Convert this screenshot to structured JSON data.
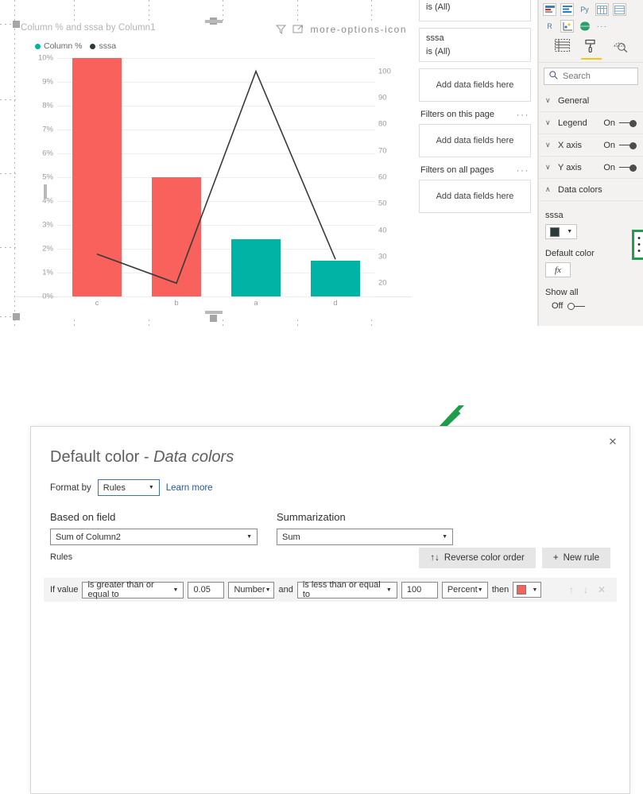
{
  "canvas": {
    "visual": {
      "title": "Column % and sssa by Column1",
      "filter_icon": "filter-icon",
      "focus_icon": "focus-mode-icon",
      "more_icon": "more-options-icon"
    }
  },
  "chart_data": {
    "type": "bar",
    "title": "Column % and sssa by Column1",
    "categories": [
      "c",
      "b",
      "a",
      "d"
    ],
    "xlabel": "",
    "ylabel": "",
    "grid": true,
    "legend_position": "top-left",
    "series": [
      {
        "name": "Column %",
        "type": "bar",
        "axis": "left",
        "values": [
          10,
          5,
          2.4,
          1.5
        ],
        "ylim": [
          0,
          10
        ],
        "yticks": [
          "0%",
          "1%",
          "2%",
          "3%",
          "4%",
          "5%",
          "6%",
          "7%",
          "8%",
          "9%",
          "10%"
        ],
        "colors": [
          "#f9615c",
          "#f9615c",
          "#00b3a4",
          "#00b3a4"
        ]
      },
      {
        "name": "sssa",
        "type": "line",
        "axis": "right",
        "values": [
          31,
          20,
          100,
          29
        ],
        "ylim": [
          15,
          105
        ],
        "yticks": [
          "20",
          "30",
          "40",
          "50",
          "60",
          "70",
          "80",
          "90",
          "100"
        ],
        "color": "#3a3a3a"
      }
    ],
    "legend": [
      {
        "label": "Column %",
        "color": "#00b3a4"
      },
      {
        "label": "sssa",
        "color": "#2b3a3a"
      }
    ]
  },
  "filters_pane": {
    "card_top_value": "is (All)",
    "card_field": "sssa",
    "card_field_value": "is (All)",
    "visual_drop": "Add data fields here",
    "page_section_title": "Filters on this page",
    "page_drop": "Add data fields here",
    "all_pages_section_title": "Filters on all pages",
    "all_pages_drop": "Add data fields here",
    "more_icon": "more-options-icon"
  },
  "viz_pane": {
    "icons": [
      "key-influencers-icon",
      "decomposition-tree-icon",
      "py-visual-icon",
      "matrix-icon",
      "table-icon",
      "r-visual-icon",
      "scatter-icon",
      "globe-map-icon",
      "more-visuals-icon"
    ],
    "py_label": "Py",
    "r_label": "R",
    "more_label": "···",
    "tabs": [
      {
        "name": "fields-tab",
        "icon": "fields-table-icon",
        "active": false
      },
      {
        "name": "format-tab",
        "icon": "paint-roller-icon",
        "active": true
      },
      {
        "name": "analytics-tab",
        "icon": "magnifier-icon",
        "active": false
      }
    ],
    "search_placeholder": "Search",
    "search_value": "",
    "sections": [
      {
        "label": "General",
        "state": "",
        "expanded": false
      },
      {
        "label": "Legend",
        "state": "On",
        "expanded": false
      },
      {
        "label": "X axis",
        "state": "On",
        "expanded": false
      },
      {
        "label": "Y axis",
        "state": "On",
        "expanded": false
      },
      {
        "label": "Data colors",
        "state": "",
        "expanded": true
      }
    ],
    "data_colors": {
      "series_label": "sssa",
      "series_color": "#2b3a3a",
      "default_color_label": "Default color",
      "fx_label": "fx",
      "ellipsis_label": "⋮",
      "show_all_label": "Show all",
      "show_all_state": "Off"
    }
  },
  "dialog": {
    "close_label": "✕",
    "title_main": "Default color",
    "title_sep": " - ",
    "title_italic": "Data colors",
    "format_by_label": "Format by",
    "format_by_value": "Rules",
    "learn_more": "Learn more",
    "based_on_field_label": "Based on field",
    "based_on_field_value": "Sum of Column2",
    "summarization_label": "Summarization",
    "summarization_value": "Sum",
    "rules_label": "Rules",
    "reverse_button": "Reverse color order",
    "reverse_icon": "↑↓",
    "new_rule_button": "New rule",
    "new_rule_icon": "+",
    "rule": {
      "if_value_label": "If value",
      "condition1": "is greater than or equal to",
      "value1": "0.05",
      "unit1": "Number",
      "and_label": "and",
      "condition2": "is less than or equal to",
      "value2": "100",
      "unit2": "Percent",
      "then_label": "then",
      "then_color": "#f9615c",
      "move_up_icon": "↑",
      "move_down_icon": "↓",
      "delete_icon": "✕"
    }
  },
  "annotation": {
    "color": "#1e9e4a",
    "name": "green-arrow-annotation"
  }
}
